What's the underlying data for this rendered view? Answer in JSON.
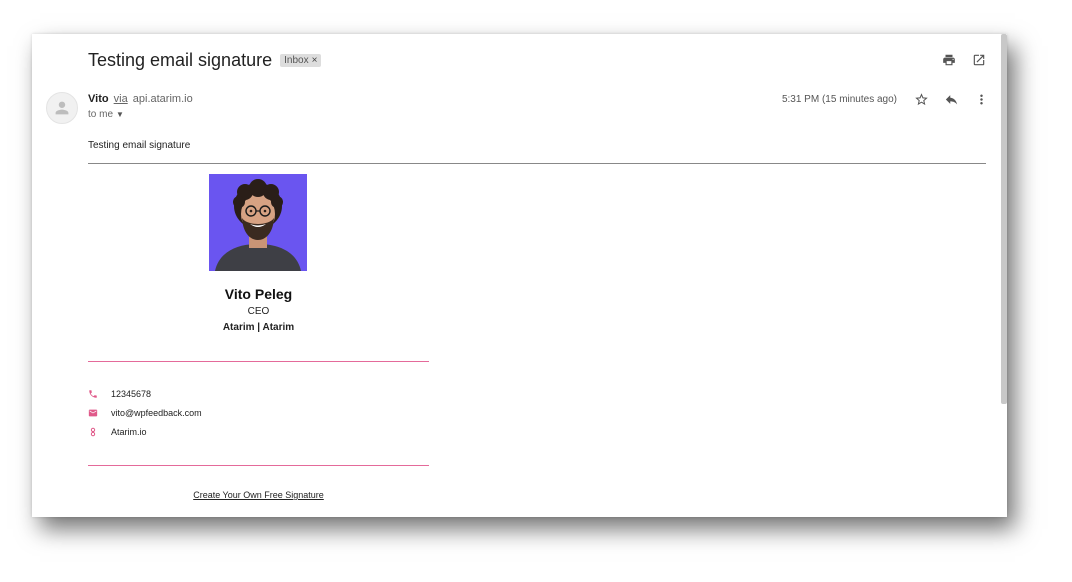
{
  "email": {
    "subject": "Testing email signature",
    "label_chip": "Inbox",
    "label_chip_close": "×",
    "sender_name": "Vito",
    "via_text": "via",
    "via_domain": "api.atarim.io",
    "recipient_text": "to me",
    "timestamp": "5:31 PM (15 minutes ago)",
    "body_text": "Testing email signature"
  },
  "signature": {
    "name": "Vito Peleg",
    "title": "CEO",
    "company": "Atarim | Atarim",
    "phone": "12345678",
    "email": "vito@wpfeedback.com",
    "website": "Atarim.io",
    "cta": "Create Your Own Free Signature",
    "accent_color": "#e46a9a",
    "photo_bg_color": "#6a55f0"
  },
  "icons": {
    "print": "print-icon",
    "open_new_window": "open-in-new-window-icon",
    "star": "star-icon",
    "reply": "reply-icon",
    "more": "more-vertical-icon",
    "avatar": "person-icon",
    "phone": "phone-icon",
    "email": "mail-icon",
    "website": "link-icon"
  }
}
